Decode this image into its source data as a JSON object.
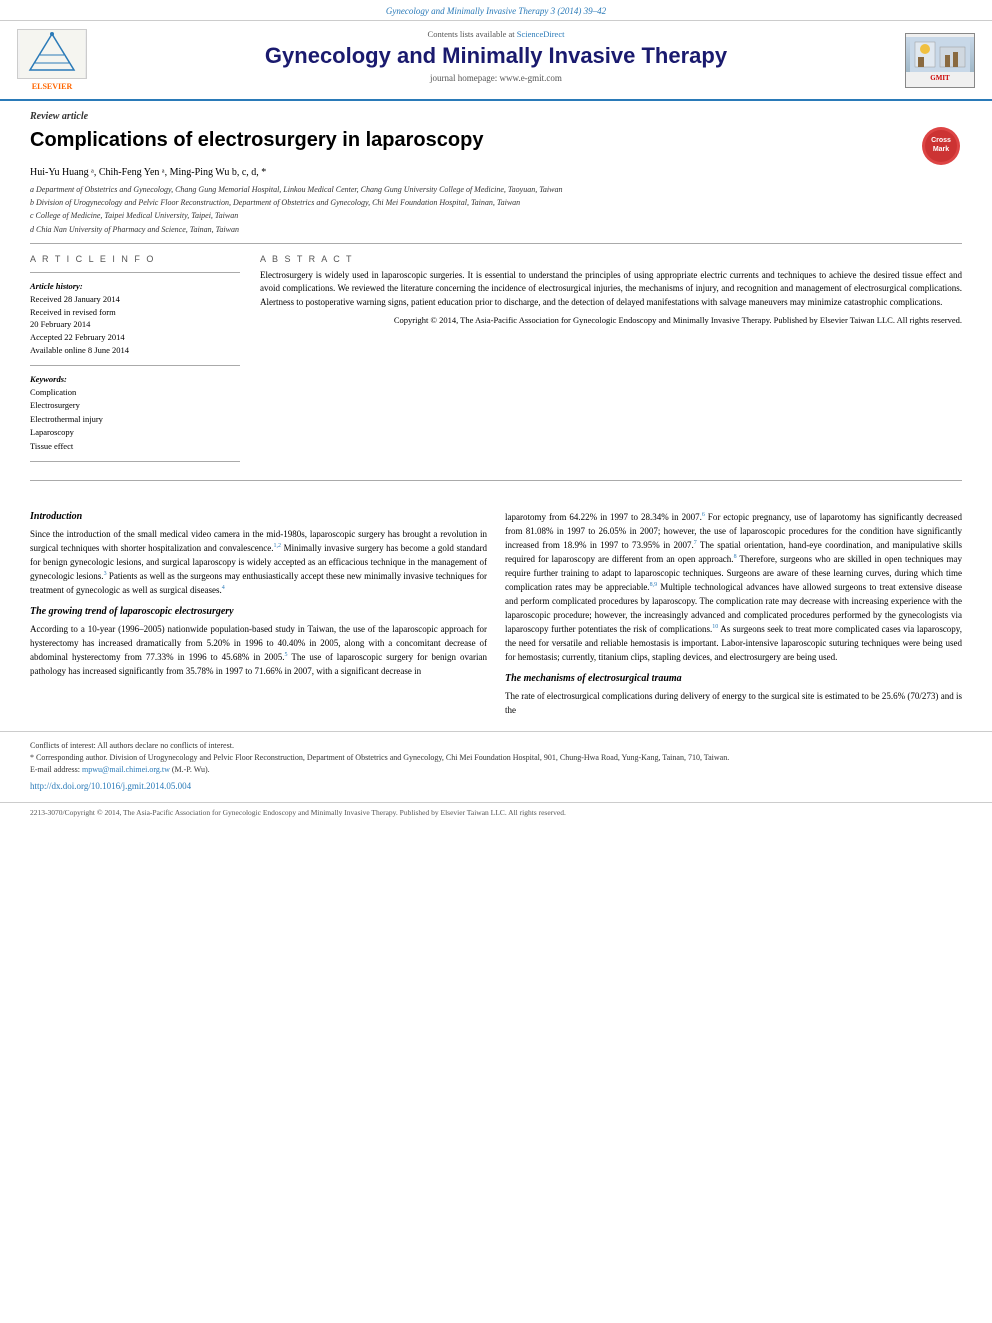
{
  "topbar": {
    "citation": "Gynecology and Minimally Invasive Therapy 3 (2014) 39–42"
  },
  "journal_header": {
    "contents_text": "Contents lists available at",
    "contents_link": "ScienceDirect",
    "journal_title": "Gynecology and Minimally Invasive Therapy",
    "homepage_label": "journal homepage: www.e-gmit.com",
    "elsevier_text": "ELSEVIER",
    "gmit_text": "GMIT"
  },
  "article": {
    "type_label": "Review article",
    "title": "Complications of electrosurgery in laparoscopy",
    "authors": "Hui-Yu Huang ᵃ, Chih-Feng Yen ᵃ, Ming-Ping Wu b, c, d, *",
    "affiliations": [
      "a Department of Obstetrics and Gynecology, Chang Gung Memorial Hospital, Linkou Medical Center, Chang Gung University College of Medicine, Taoyuan, Taiwan",
      "b Division of Urogynecology and Pelvic Floor Reconstruction, Department of Obstetrics and Gynecology, Chi Mei Foundation Hospital, Tainan, Taiwan",
      "c College of Medicine, Taipei Medical University, Taipei, Taiwan",
      "d Chia Nan University of Pharmacy and Science, Tainan, Taiwan"
    ]
  },
  "article_info": {
    "section_label": "A R T I C L E   I N F O",
    "history_label": "Article history:",
    "received": "Received 28 January 2014",
    "received_revised": "Received in revised form 20 February 2014",
    "accepted": "Accepted 22 February 2014",
    "available": "Available online 8 June 2014",
    "keywords_label": "Keywords:",
    "keywords": [
      "Complication",
      "Electrosurgery",
      "Electrothermal injury",
      "Laparoscopy",
      "Tissue effect"
    ]
  },
  "abstract": {
    "section_label": "A B S T R A C T",
    "text": "Electrosurgery is widely used in laparoscopic surgeries. It is essential to understand the principles of using appropriate electric currents and techniques to achieve the desired tissue effect and avoid complications. We reviewed the literature concerning the incidence of electrosurgical injuries, the mechanisms of injury, and recognition and management of electrosurgical complications. Alertness to postoperative warning signs, patient education prior to discharge, and the detection of delayed manifestations with salvage maneuvers may minimize catastrophic complications.",
    "copyright": "Copyright © 2014, The Asia-Pacific Association for Gynecologic Endoscopy and Minimally Invasive Therapy. Published by Elsevier Taiwan LLC. All rights reserved."
  },
  "introduction": {
    "title": "Introduction",
    "text": "Since the introduction of the small medical video camera in the mid-1980s, laparoscopic surgery has brought a revolution in surgical techniques with shorter hospitalization and convalescence.1,2 Minimally invasive surgery has become a gold standard for benign gynecologic lesions, and surgical laparoscopy is widely accepted as an efficacious technique in the management of gynecologic lesions.3 Patients as well as the surgeons may enthusiastically accept these new minimally invasive techniques for treatment of gynecologic as well as surgical diseases.4"
  },
  "growing_trend": {
    "title": "The growing trend of laparoscopic electrosurgery",
    "text": "According to a 10-year (1996–2005) nationwide population-based study in Taiwan, the use of the laparoscopic approach for hysterectomy has increased dramatically from 5.20% in 1996 to 40.40% in 2005, along with a concomitant decrease of abdominal hysterectomy from 77.33% in 1996 to 45.68% in 2005.5 The use of laparoscopic surgery for benign ovarian pathology has increased significantly from 35.78% in 1997 to 71.66% in 2007, with a significant decrease in laparotomy from 64.22% in 1997 to 28.34% in 2007.6 For ectopic pregnancy, use of laparotomy has significantly decreased from 81.08% in 1997 to 26.05% in 2007; however, the use of laparoscopic procedures for the condition have significantly increased from 18.9% in 1997 to 73.95% in 2007.7 The spatial orientation, hand-eye coordination, and manipulative skills required for laparoscopy are different from an open approach.8 Therefore, surgeons who are skilled in open techniques may require further training to adapt to laparoscopic techniques. Surgeons are aware of these learning curves, during which time complication rates may be appreciable.8,9 Multiple technological advances have allowed surgeons to treat extensive disease and perform complicated procedures by laparoscopy. The complication rate may decrease with increasing experience with the laparoscopic procedure; however, the increasingly advanced and complicated procedures performed by the gynecologists via laparoscopy further potentiates the risk of complications.10 As surgeons seek to treat more complicated cases via laparoscopy, the need for versatile and reliable hemostasis is important. Labor-intensive laparoscopic suturing techniques were being used for hemostasis; currently, titanium clips, stapling devices, and electrosurgery are being used."
  },
  "mechanisms": {
    "title": "The mechanisms of electrosurgical trauma",
    "text": "The rate of electrosurgical complications during delivery of energy to the surgical site is estimated to be 25.6% (70/273) and is the"
  },
  "footnotes": {
    "conflicts": "Conflicts of interest: All authors declare no conflicts of interest.",
    "corresponding_label": "* Corresponding",
    "corresponding_text": "author. Division of Urogynecology and Pelvic Floor Reconstruction, Department of Obstetrics and Gynecology, Chi Mei Foundation Hospital, 901, Chung-Hwa Road, Yung-Kang, Tainan, 710, Taiwan.",
    "email_label": "E-mail address:",
    "email": "mpwu@mail.chimei.org.tw",
    "email_suffix": "(M.-P. Wu)."
  },
  "doi": {
    "text": "http://dx.doi.org/10.1016/j.gmit.2014.05.004"
  },
  "bottom_copyright": {
    "text": "2213-3070/Copyright © 2014, The Asia-Pacific Association for Gynecologic Endoscopy and Minimally Invasive Therapy. Published by Elsevier Taiwan LLC. All rights reserved."
  }
}
